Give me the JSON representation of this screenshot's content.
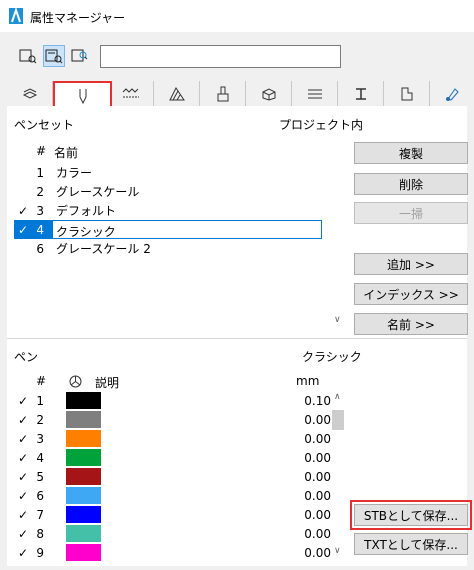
{
  "window": {
    "title": "属性マネージャー"
  },
  "toolbar": {
    "icons": [
      "view-icon-1",
      "view-icon-2-active",
      "view-icon-3"
    ],
    "search_value": ""
  },
  "tabs": [
    "layers",
    "pens",
    "fills",
    "surface-hatch",
    "materials",
    "composites",
    "profiles",
    "zones",
    "building-materials",
    "line-types"
  ],
  "penset_section": {
    "title": "ペンセット",
    "scope": "プロジェクト内",
    "header_num": "#",
    "header_name": "名前",
    "rows": [
      {
        "check": "",
        "num": "1",
        "name": "カラー"
      },
      {
        "check": "",
        "num": "2",
        "name": "グレースケール"
      },
      {
        "check": "✓",
        "num": "3",
        "name": "デフォルト"
      },
      {
        "check": "✓",
        "num": "4",
        "name": "クラシック"
      },
      {
        "check": "",
        "num": "6",
        "name": "グレースケール 2"
      }
    ]
  },
  "buttons": {
    "duplicate": "複製",
    "delete": "削除",
    "purge": "一掃",
    "add": "追加 >>",
    "index": "インデックス >>",
    "name": "名前 >>",
    "save_stb": "STBとして保存...",
    "save_txt": "TXTとして保存..."
  },
  "pen_section": {
    "title": "ペン",
    "current_set": "クラシック",
    "header_num": "#",
    "header_desc": "説明",
    "header_unit": "mm",
    "rows": [
      {
        "check": "✓",
        "num": "1",
        "color": "#000000",
        "value": "0.10"
      },
      {
        "check": "✓",
        "num": "2",
        "color": "#7f7f7f",
        "value": "0.00"
      },
      {
        "check": "✓",
        "num": "3",
        "color": "#ff7f00",
        "value": "0.00"
      },
      {
        "check": "✓",
        "num": "4",
        "color": "#00a23c",
        "value": "0.00"
      },
      {
        "check": "✓",
        "num": "5",
        "color": "#a51417",
        "value": "0.00"
      },
      {
        "check": "✓",
        "num": "6",
        "color": "#3fa8f5",
        "value": "0.00"
      },
      {
        "check": "✓",
        "num": "7",
        "color": "#0000ff",
        "value": "0.00"
      },
      {
        "check": "✓",
        "num": "8",
        "color": "#44c0a8",
        "value": "0.00"
      },
      {
        "check": "✓",
        "num": "9",
        "color": "#ff00cc",
        "value": "0.00"
      }
    ]
  }
}
